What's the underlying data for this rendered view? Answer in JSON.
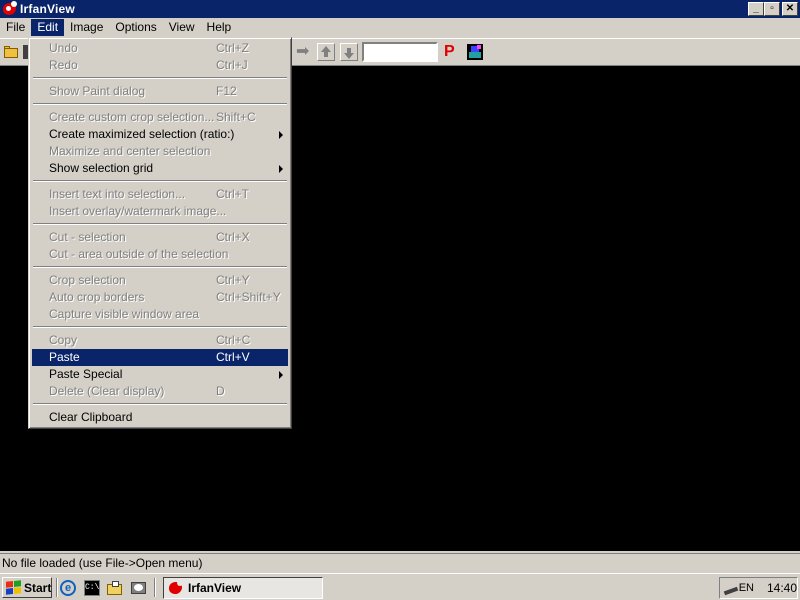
{
  "window": {
    "title": "IrfanView"
  },
  "menubar": {
    "items": [
      "File",
      "Edit",
      "Image",
      "Options",
      "View",
      "Help"
    ],
    "active": "Edit"
  },
  "title_buttons": {
    "minimize": "_",
    "maximize": "▫",
    "close": "✕"
  },
  "toolbar": {
    "page_input_value": ""
  },
  "edit_menu": {
    "undo": {
      "label": "Undo",
      "shortcut": "Ctrl+Z"
    },
    "redo": {
      "label": "Redo",
      "shortcut": "Ctrl+J"
    },
    "show_paint": {
      "label": "Show Paint dialog",
      "shortcut": "F12"
    },
    "custom_crop": {
      "label": "Create custom crop selection...",
      "shortcut": "Shift+C"
    },
    "max_selection": {
      "label": "Create maximized selection (ratio:)"
    },
    "max_center": {
      "label": "Maximize and center selection"
    },
    "show_grid": {
      "label": "Show selection grid"
    },
    "insert_text": {
      "label": "Insert text into selection...",
      "shortcut": "Ctrl+T"
    },
    "insert_overlay": {
      "label": "Insert overlay/watermark image..."
    },
    "cut_selection": {
      "label": "Cut - selection",
      "shortcut": "Ctrl+X"
    },
    "cut_outside": {
      "label": "Cut - area outside of the selection"
    },
    "crop_selection": {
      "label": "Crop selection",
      "shortcut": "Ctrl+Y"
    },
    "auto_crop": {
      "label": "Auto crop borders",
      "shortcut": "Ctrl+Shift+Y"
    },
    "capture": {
      "label": "Capture visible window area"
    },
    "copy": {
      "label": "Copy",
      "shortcut": "Ctrl+C"
    },
    "paste": {
      "label": "Paste",
      "shortcut": "Ctrl+V"
    },
    "paste_special": {
      "label": "Paste Special"
    },
    "delete": {
      "label": "Delete (Clear display)",
      "shortcut": "D"
    },
    "clear_clipboard": {
      "label": "Clear Clipboard"
    }
  },
  "statusbar": {
    "text": "No file loaded (use File->Open menu)"
  },
  "taskbar": {
    "start_label": "Start",
    "cmd_label": "C:\\",
    "ie_label": "e",
    "task_label": "IrfanView",
    "language": "EN",
    "clock": "14:40"
  },
  "colors": {
    "titlebar": "#0a246a",
    "highlight": "#0a246a",
    "face": "#d4d0c8",
    "canvas": "#000000"
  }
}
